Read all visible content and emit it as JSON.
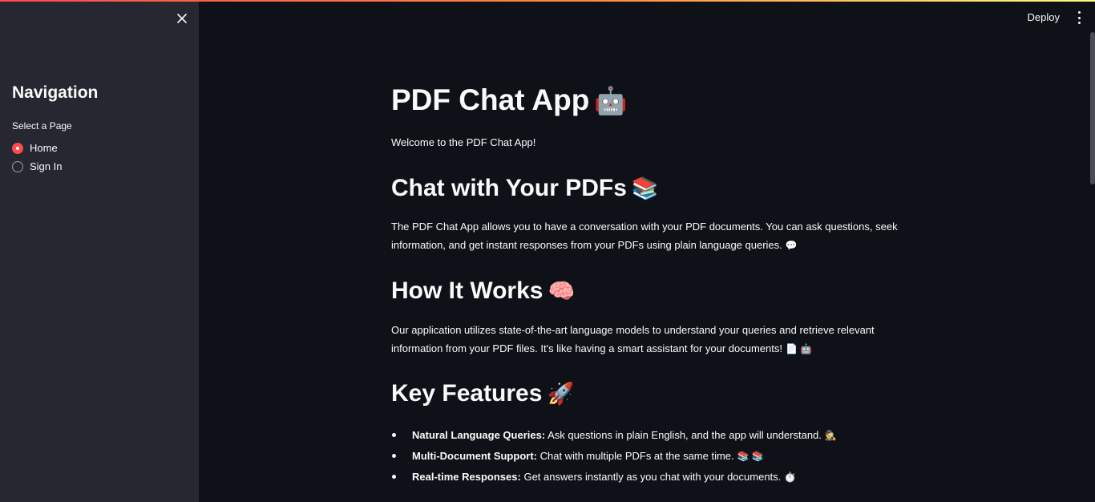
{
  "sidebar": {
    "title": "Navigation",
    "radio_label": "Select a Page",
    "options": [
      {
        "label": "Home",
        "selected": true
      },
      {
        "label": "Sign In",
        "selected": false
      }
    ]
  },
  "header": {
    "deploy_label": "Deploy"
  },
  "main": {
    "title": "PDF Chat App",
    "title_emoji": "🤖",
    "welcome": "Welcome to the PDF Chat App!",
    "section1": {
      "heading": "Chat with Your PDFs",
      "emoji": "📚",
      "body": "The PDF Chat App allows you to have a conversation with your PDF documents. You can ask questions, seek information, and get instant responses from your PDFs using plain language queries.",
      "body_emoji": "💬"
    },
    "section2": {
      "heading": "How It Works",
      "emoji": "🧠",
      "body": "Our application utilizes state-of-the-art language models to understand your queries and retrieve relevant information from your PDF files. It's like having a smart assistant for your documents!",
      "body_emoji": "📄 🤖"
    },
    "section3": {
      "heading": "Key Features",
      "emoji": "🚀",
      "features": [
        {
          "title": "Natural Language Queries:",
          "text": "Ask questions in plain English, and the app will understand.",
          "emoji": "🕵️"
        },
        {
          "title": "Multi-Document Support:",
          "text": "Chat with multiple PDFs at the same time.",
          "emoji": "📚 📚"
        },
        {
          "title": "Real-time Responses:",
          "text": "Get answers instantly as you chat with your documents.",
          "emoji": "⏱️"
        }
      ]
    }
  },
  "colors": {
    "background": "#0e1117",
    "sidebar": "#262730",
    "accent": "#ff4b4b"
  }
}
